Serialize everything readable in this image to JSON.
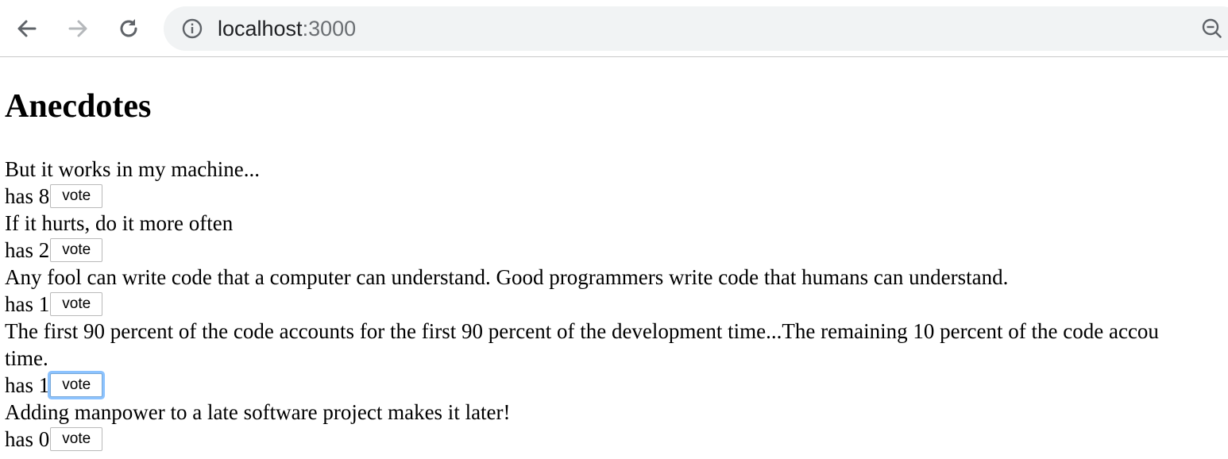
{
  "browser": {
    "url_host": "localhost",
    "url_port": ":3000",
    "icons": [
      "back-arrow-icon",
      "forward-arrow-icon",
      "reload-icon",
      "info-icon",
      "zoom-icon"
    ]
  },
  "page": {
    "title": "Anecdotes",
    "vote_label": "vote",
    "votes_prefix": "has",
    "focused_vote_index": 3,
    "anecdotes": [
      {
        "content": "But it works in my machine...",
        "votes": "8"
      },
      {
        "content": "If it hurts, do it more often",
        "votes": "2"
      },
      {
        "content": "Any fool can write code that a computer can understand. Good programmers write code that humans can understand.",
        "votes": "1"
      },
      {
        "content": "The first 90 percent of the code accounts for the first 90 percent of the development time...The remaining 10 percent of the code accou",
        "content_line2": "time.",
        "votes": "1"
      },
      {
        "content": "Adding manpower to a late software project makes it later!",
        "votes": "0"
      }
    ]
  }
}
